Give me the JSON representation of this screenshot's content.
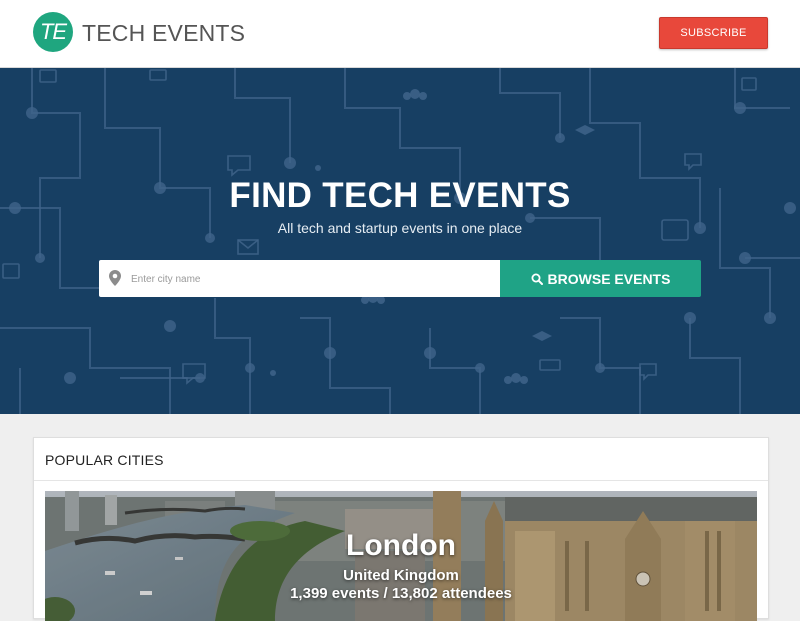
{
  "header": {
    "logo_text": "TE",
    "brand_name": "TECH EVENTS",
    "subscribe_label": "SUBSCRIBE"
  },
  "hero": {
    "title": "FIND TECH EVENTS",
    "subtitle": "All tech and startup events in one place",
    "search": {
      "placeholder": "Enter city name",
      "value": ""
    },
    "browse_label": "BROWSE EVENTS"
  },
  "popular": {
    "heading": "POPULAR CITIES",
    "cities": [
      {
        "name": "London",
        "country": "United Kingdom",
        "stats": "1,399 events / 13,802 attendees"
      }
    ]
  },
  "icons": [
    "te-logo-icon",
    "map-pin-icon",
    "search-icon",
    "calendar-icon",
    "people-icon",
    "chat-bubble-icon",
    "graduation-cap-icon",
    "envelope-icon",
    "id-card-icon",
    "network-icon"
  ],
  "colors": {
    "brand_green": "#1fa67f",
    "subscribe_red": "#e8483b",
    "hero_navy": "#173f63",
    "browse_teal": "#1fa386"
  }
}
